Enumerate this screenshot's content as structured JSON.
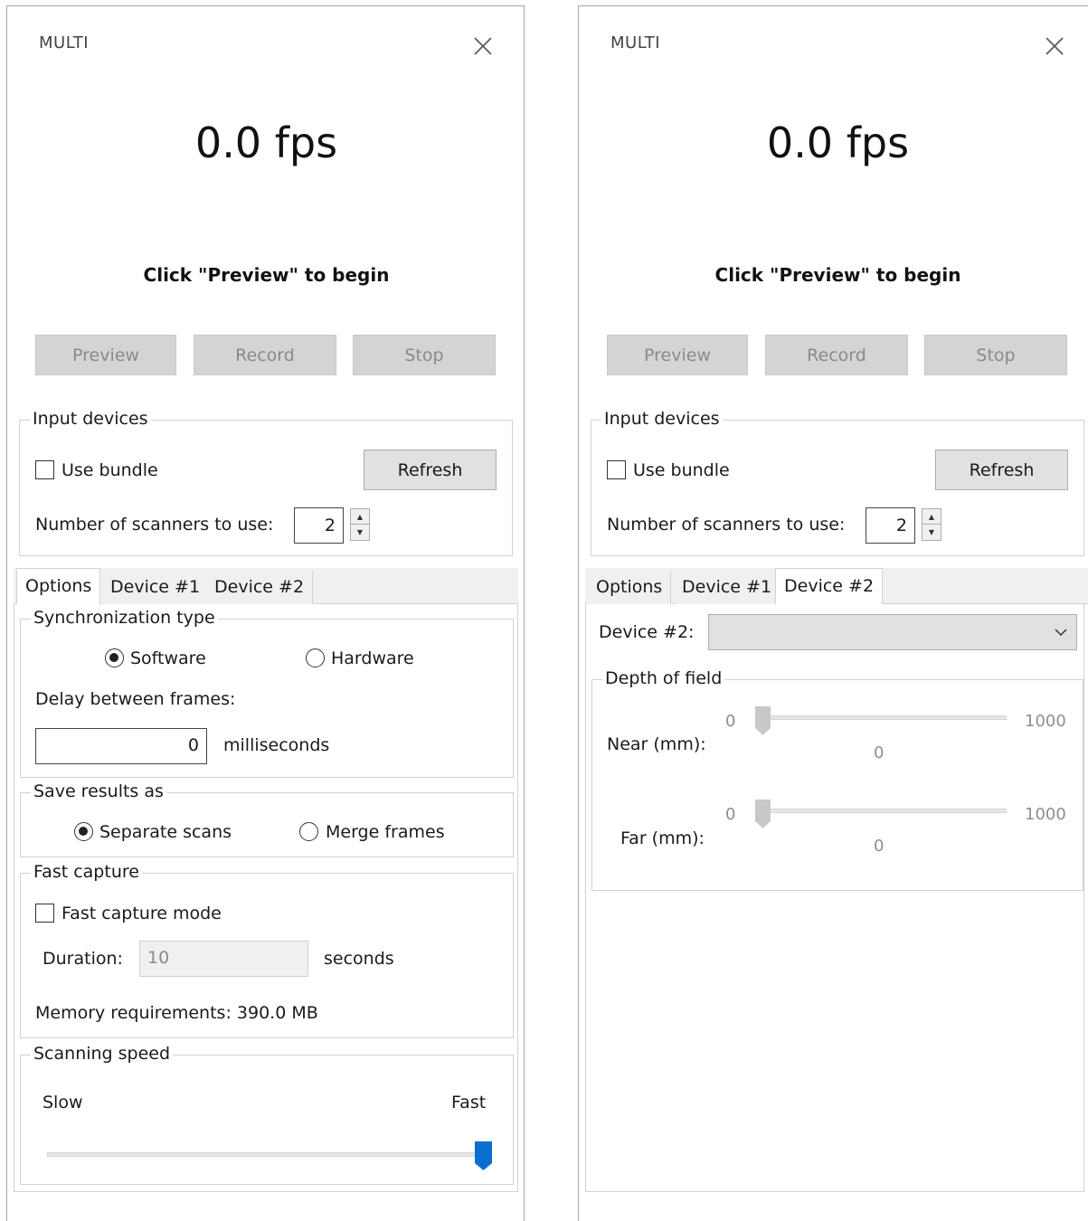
{
  "left_panel": {
    "title": "MULTI",
    "fps": "0.0 fps",
    "hint": "Click \"Preview\" to begin",
    "buttons": {
      "preview": "Preview",
      "record": "Record",
      "stop": "Stop"
    },
    "input_devices": {
      "legend": "Input devices",
      "use_bundle": "Use bundle",
      "use_bundle_checked": false,
      "refresh": "Refresh",
      "scanners_label": "Number of scanners to use:",
      "scanners_value": "2"
    },
    "tabs": [
      "Options",
      "Device #1",
      "Device #2"
    ],
    "active_tab": "Options",
    "options": {
      "sync": {
        "legend": "Synchronization type",
        "software": "Software",
        "hardware": "Hardware",
        "selected": "Software",
        "delay_label": "Delay between frames:",
        "delay_value": "0",
        "delay_unit": "milliseconds"
      },
      "save": {
        "legend": "Save results as",
        "separate": "Separate scans",
        "merge": "Merge frames",
        "selected": "Separate scans"
      },
      "fast": {
        "legend": "Fast capture",
        "mode": "Fast capture mode",
        "mode_checked": false,
        "duration_label": "Duration:",
        "duration_value": "10",
        "duration_unit": "seconds",
        "memory": "Memory requirements: 390.0 MB"
      },
      "speed": {
        "legend": "Scanning speed",
        "slow": "Slow",
        "fast": "Fast",
        "value_fraction": 1.0
      }
    }
  },
  "right_panel": {
    "title": "MULTI",
    "fps": "0.0 fps",
    "hint": "Click \"Preview\" to begin",
    "buttons": {
      "preview": "Preview",
      "record": "Record",
      "stop": "Stop"
    },
    "input_devices": {
      "legend": "Input devices",
      "use_bundle": "Use bundle",
      "use_bundle_checked": false,
      "refresh": "Refresh",
      "scanners_label": "Number of scanners to use:",
      "scanners_value": "2"
    },
    "tabs": [
      "Options",
      "Device #1",
      "Device #2"
    ],
    "active_tab": "Device #2",
    "device2": {
      "device_label": "Device #2:",
      "device_value": "",
      "dof": {
        "legend": "Depth of field",
        "near_label": "Near (mm):",
        "near_min": "0",
        "near_max": "1000",
        "near_value": "0",
        "far_label": "Far (mm):",
        "far_min": "0",
        "far_max": "1000",
        "far_value": "0"
      }
    }
  },
  "colors": {
    "slider_accent": "#0a6ed1",
    "disabled_text": "#8a8a8a"
  }
}
